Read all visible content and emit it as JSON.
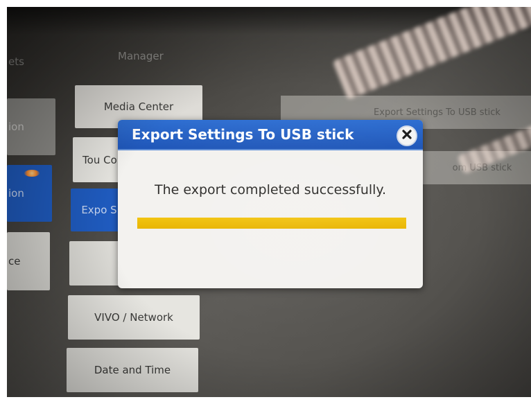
{
  "menu": {
    "manager_label": "Manager",
    "left_items": [
      {
        "label": "ets"
      },
      {
        "label": "ion"
      },
      {
        "label": "ion"
      },
      {
        "label": "ce"
      }
    ],
    "items": [
      {
        "label": "Media Center"
      },
      {
        "label": "Tou Cor"
      },
      {
        "label": "Expo S"
      },
      {
        "label": ""
      },
      {
        "label": "VIVO / Network"
      },
      {
        "label": "Date and Time"
      }
    ],
    "right_actions": [
      {
        "label": "Export Settings To USB stick"
      },
      {
        "label": "om USB stick"
      }
    ]
  },
  "dialog": {
    "title": "Export Settings To USB stick",
    "message": "The export completed successfully.",
    "progress_percent": 100,
    "close_icon": "close-icon"
  },
  "colors": {
    "header_blue": "#1f56b8",
    "progress_yellow": "#f2c40f",
    "selected_tile": "#1f5bbf"
  }
}
